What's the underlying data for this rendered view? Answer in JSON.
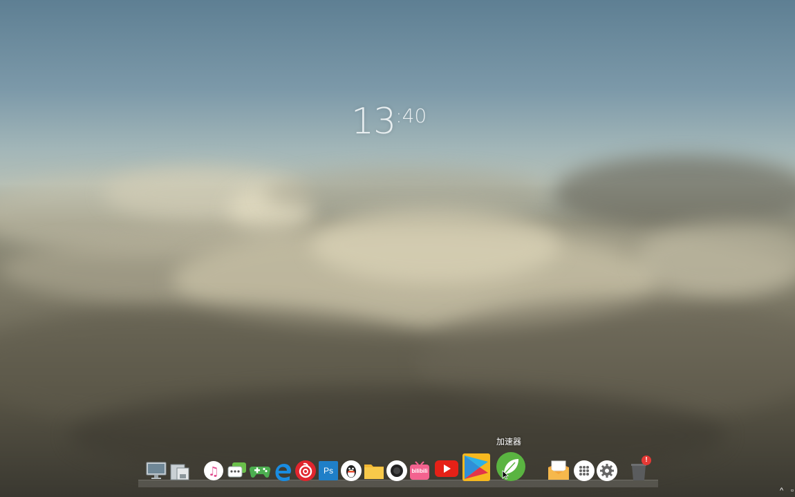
{
  "wallpaper": {
    "sky_color": "#7c99a9",
    "cloud_color": "#b8b29a"
  },
  "clock": {
    "hour": "13",
    "minute": ":40"
  },
  "tooltip": {
    "text": "加速器"
  },
  "dock": {
    "items": [
      {
        "icon": "monitor-icon"
      },
      {
        "icon": "file-manager-icon"
      },
      {
        "icon": "music-icon"
      },
      {
        "icon": "chat-icon"
      },
      {
        "icon": "gamepad-icon"
      },
      {
        "icon": "edge-browser-icon"
      },
      {
        "icon": "netease-music-icon"
      },
      {
        "icon": "photoshop-icon",
        "label": "Ps"
      },
      {
        "icon": "qq-penguin-icon"
      },
      {
        "icon": "folder-icon"
      },
      {
        "icon": "record-icon"
      },
      {
        "icon": "bilibili-icon",
        "label": "bilibili"
      },
      {
        "icon": "youtube-icon"
      },
      {
        "icon": "play-store-icon"
      },
      {
        "icon": "accelerator-leaf-icon"
      },
      {
        "icon": "mail-box-icon"
      },
      {
        "icon": "app-launcher-icon"
      },
      {
        "icon": "settings-gear-icon"
      },
      {
        "icon": "trash-icon",
        "badge": "!"
      }
    ]
  },
  "tray": {
    "chevron": "^"
  }
}
